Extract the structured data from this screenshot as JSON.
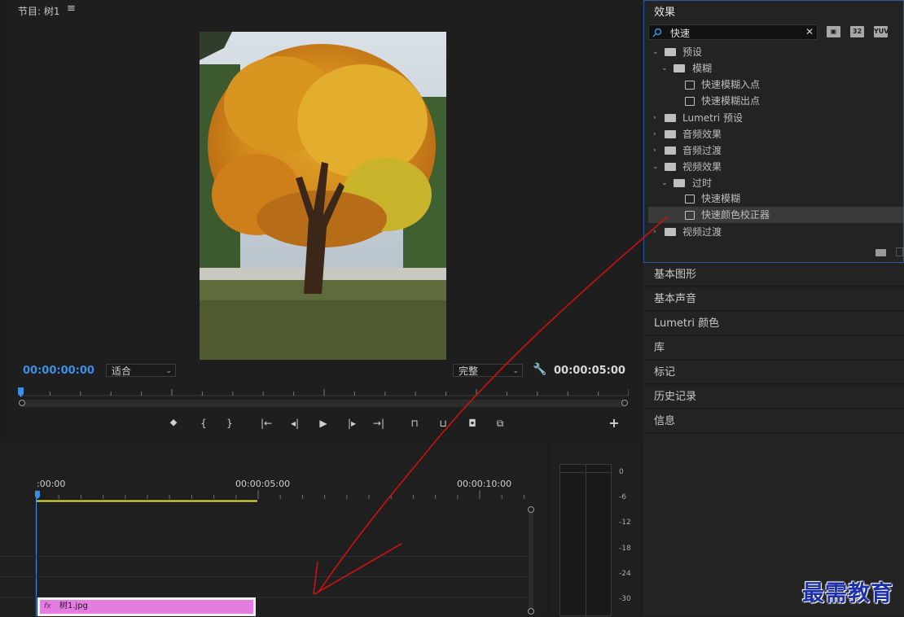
{
  "monitor": {
    "title": "节目: 树1",
    "menu_icon": "hamburger-icon",
    "timecode_current": "00:00:00:00",
    "fit_dropdown": "适合",
    "quality_dropdown": "完整",
    "timecode_duration": "00:00:05:00",
    "transport_buttons": [
      "add-marker-icon",
      "mark-in-icon",
      "mark-out-icon",
      "go-to-in-icon",
      "step-back-icon",
      "play-icon",
      "step-forward-icon",
      "go-to-out-icon",
      "lift-icon",
      "extract-icon",
      "export-frame-icon",
      "comparison-view-icon",
      "add-button-icon"
    ]
  },
  "effects": {
    "title": "效果",
    "search_value": "快速",
    "clear_symbol": "✕",
    "badges": [
      "fx-accelerated-icon",
      "32",
      "YUV"
    ],
    "tree": [
      {
        "label": "预设",
        "expanded": true
      },
      {
        "label": "模糊",
        "expanded": true
      },
      {
        "label": "快速模糊入点"
      },
      {
        "label": "快速模糊出点"
      },
      {
        "label": "Lumetri 预设",
        "expanded": false
      },
      {
        "label": "音频效果",
        "expanded": false
      },
      {
        "label": "音频过渡",
        "expanded": false
      },
      {
        "label": "视频效果",
        "expanded": true
      },
      {
        "label": "过时",
        "expanded": true
      },
      {
        "label": "快速模糊"
      },
      {
        "label": "快速颜色校正器",
        "selected": true
      },
      {
        "label": "视频过渡",
        "expanded": false
      }
    ]
  },
  "panels": [
    "基本图形",
    "基本声音",
    "Lumetri 颜色",
    "库",
    "标记",
    "历史记录",
    "信息"
  ],
  "timeline": {
    "times": [
      ":00:00",
      "00:00:05:00",
      "00:00:10:00"
    ],
    "clip_badge": "fx",
    "clip_name": "树1.jpg"
  },
  "meter": {
    "labels": [
      "0",
      "-6",
      "-12",
      "-18",
      "-24",
      "-30"
    ]
  },
  "watermark": "最需教育",
  "colors": {
    "accent_blue": "#3d8fe6",
    "clip_pink": "#e37de0",
    "work_area_yellow": "#e8e23a",
    "annotation_red": "#cc1111",
    "watermark_blue": "#1e2fa8"
  }
}
